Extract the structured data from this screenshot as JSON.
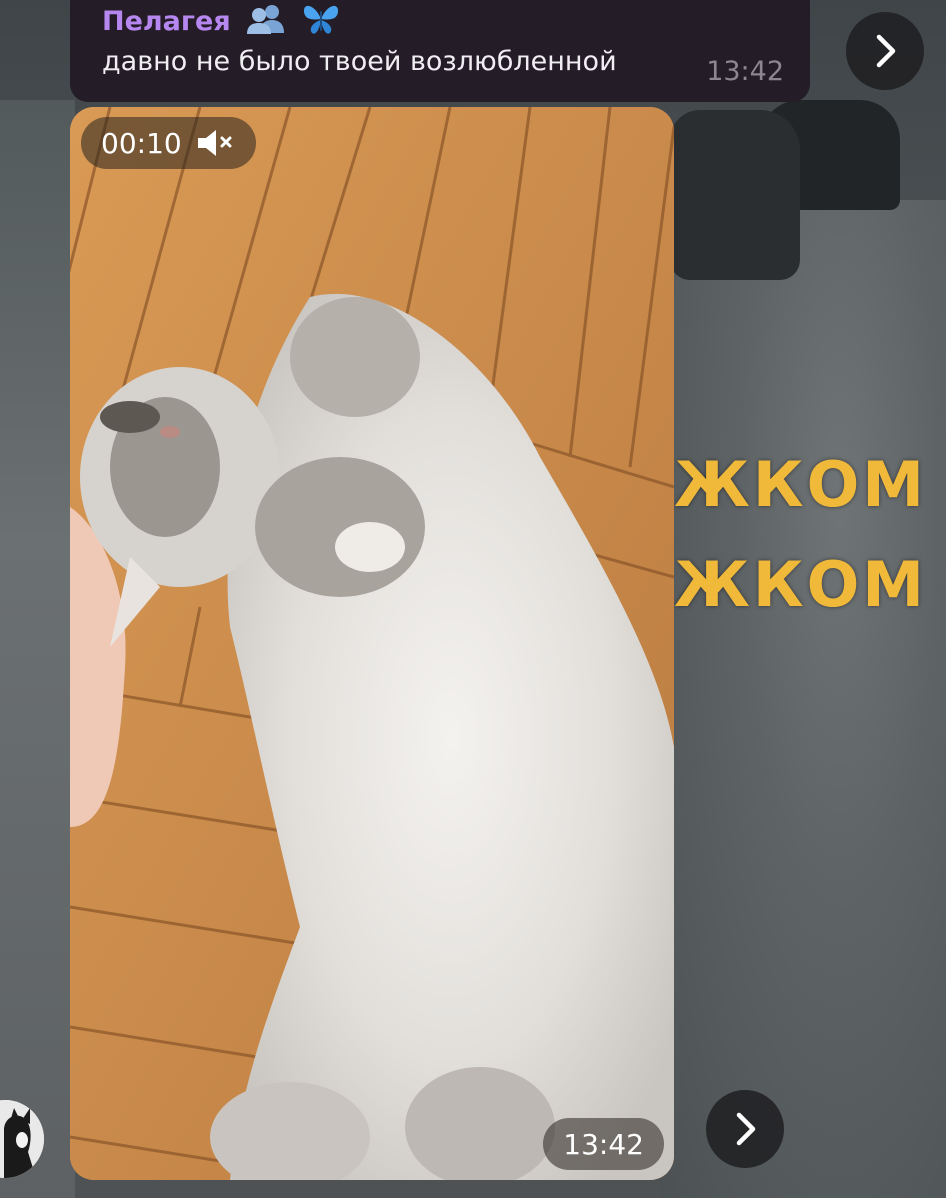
{
  "message": {
    "sender_name": "Пелагея",
    "sender_emoji_icons": [
      "busts-in-silhouette-icon",
      "butterfly-icon"
    ],
    "text": "давно не было твоей возлюбленной",
    "time": "13:42"
  },
  "video_message": {
    "duration": "00:10",
    "muted": true,
    "time": "13:42"
  },
  "background": {
    "caption_line_1": "ЖКОМ М",
    "caption_line_2": "ЖКОМ М"
  },
  "icons": {
    "forward": "chevron-right-icon",
    "mute": "speaker-muted-icon"
  },
  "colors": {
    "sender_name": "#b787f0",
    "bubble": "#241c26",
    "caption": "#f0b93a"
  }
}
